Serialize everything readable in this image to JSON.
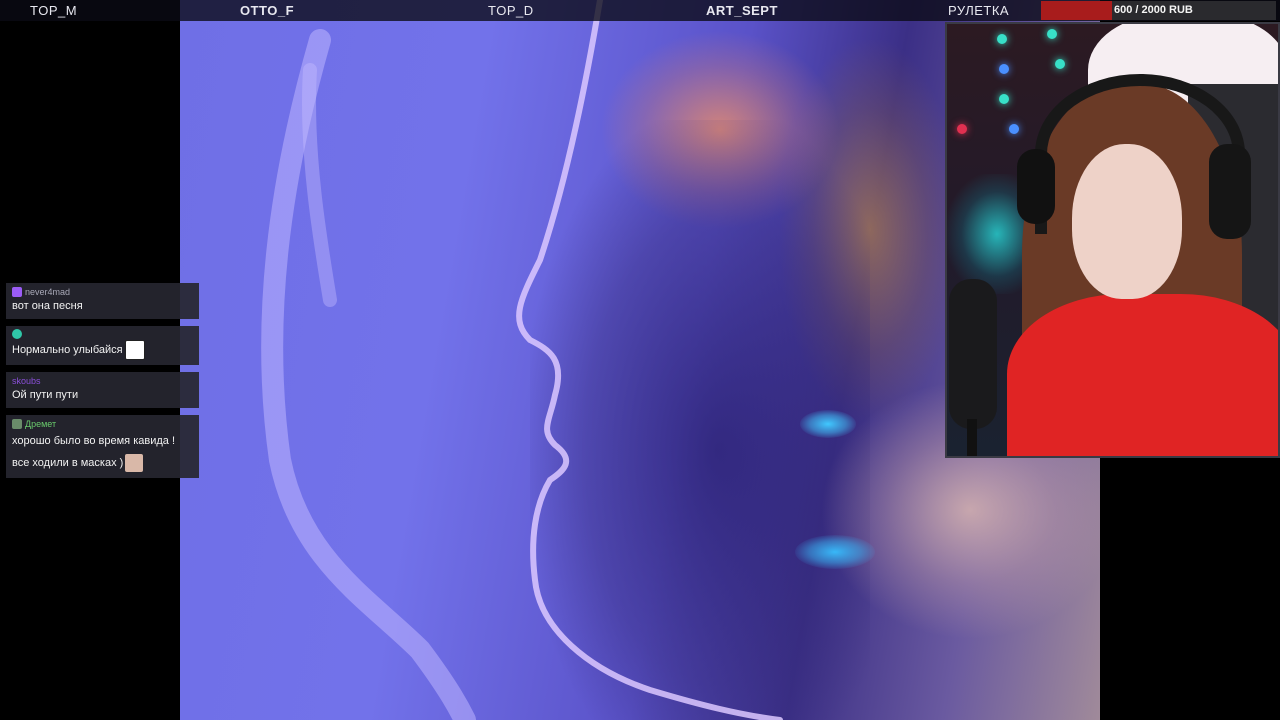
{
  "topbar": {
    "items": [
      {
        "label": "TOP_M"
      },
      {
        "label": "OTTO_F"
      },
      {
        "label": "TOP_D"
      },
      {
        "label": "ART_SEPT"
      },
      {
        "label": "РУЛЕТКА"
      }
    ],
    "goal": {
      "label": "600 / 2000 RUB",
      "progress_fraction": 0.3,
      "fill_color": "#a81c1c"
    }
  },
  "chat": {
    "messages": [
      {
        "username": "never4mad",
        "username_color": "#a9a9b8",
        "badge_icon": "star-badge-icon",
        "badge_color": "#9b5cf6",
        "lines": [
          "вот она песня"
        ]
      },
      {
        "username": "",
        "username_color": "#2a4dd8",
        "badge_icon": "gem-badge-icon",
        "badge_color": "#2fc7a8",
        "lines": [
          "Нормально улыбайся"
        ],
        "emote": "smile-emote-icon"
      },
      {
        "username": "skoubs",
        "username_color": "#8a4fd8",
        "badge_icon": "",
        "lines": [
          "Ой пути пути"
        ]
      },
      {
        "username": "Дремет",
        "username_color": "#69c96c",
        "badge_icon": "bits-badge-icon",
        "badge_color": "#6a8c6a",
        "lines": [
          "хорошо было во время кавида !",
          "все ходили в масках )"
        ],
        "emote": "face-emote-icon"
      }
    ]
  },
  "colors": {
    "topbar_bg": "#0a0a14",
    "chat_bg": "#262630"
  }
}
